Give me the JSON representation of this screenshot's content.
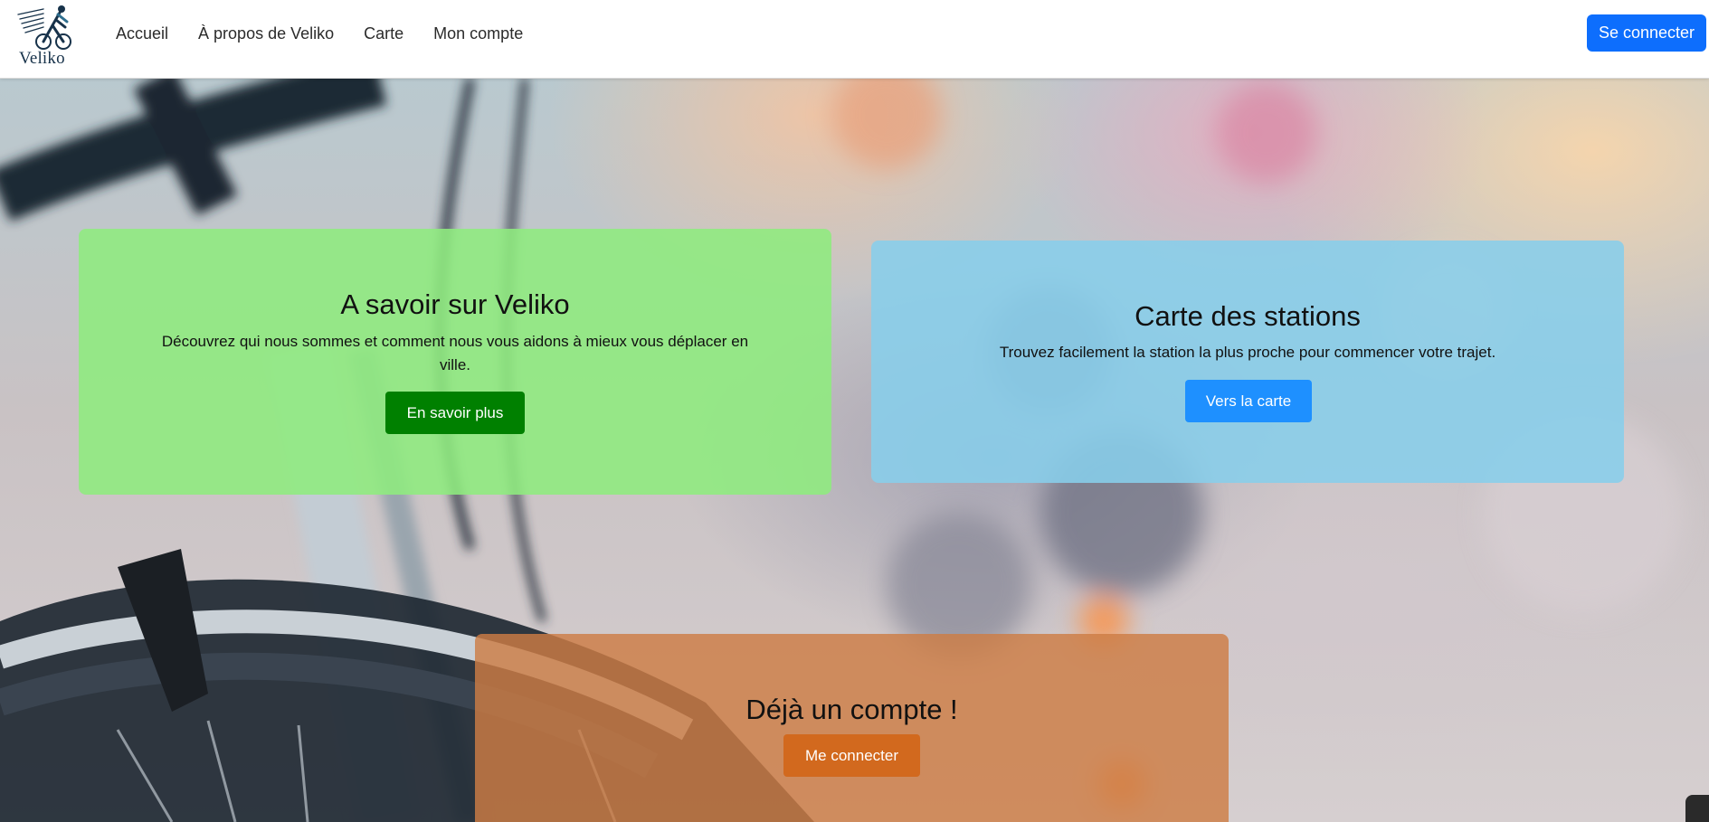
{
  "brand": {
    "name": "Veliko",
    "logo_icon": "cyclist-logo-icon"
  },
  "nav": {
    "links": [
      {
        "label": "Accueil"
      },
      {
        "label": "À propos de Veliko"
      },
      {
        "label": "Carte"
      },
      {
        "label": "Mon compte"
      }
    ],
    "login_label": "Se connecter"
  },
  "cards": {
    "about": {
      "title": "A savoir sur Veliko",
      "text": "Découvrez qui nous sommes et comment nous vous aidons à mieux vous déplacer en ville.",
      "button": "En savoir plus",
      "color": "#8eec7e",
      "button_color": "#008000"
    },
    "map": {
      "title": "Carte des stations",
      "text": "Trouvez facilement la station la plus proche pour commencer votre trajet.",
      "button": "Vers la carte",
      "color": "#87ceeb",
      "button_color": "#1e90ff"
    },
    "account": {
      "title": "Déjà un compte !",
      "button": "Me connecter",
      "color": "#cd7c44",
      "button_color": "#d2691e"
    }
  },
  "colors": {
    "primary": "#0d6efd"
  }
}
